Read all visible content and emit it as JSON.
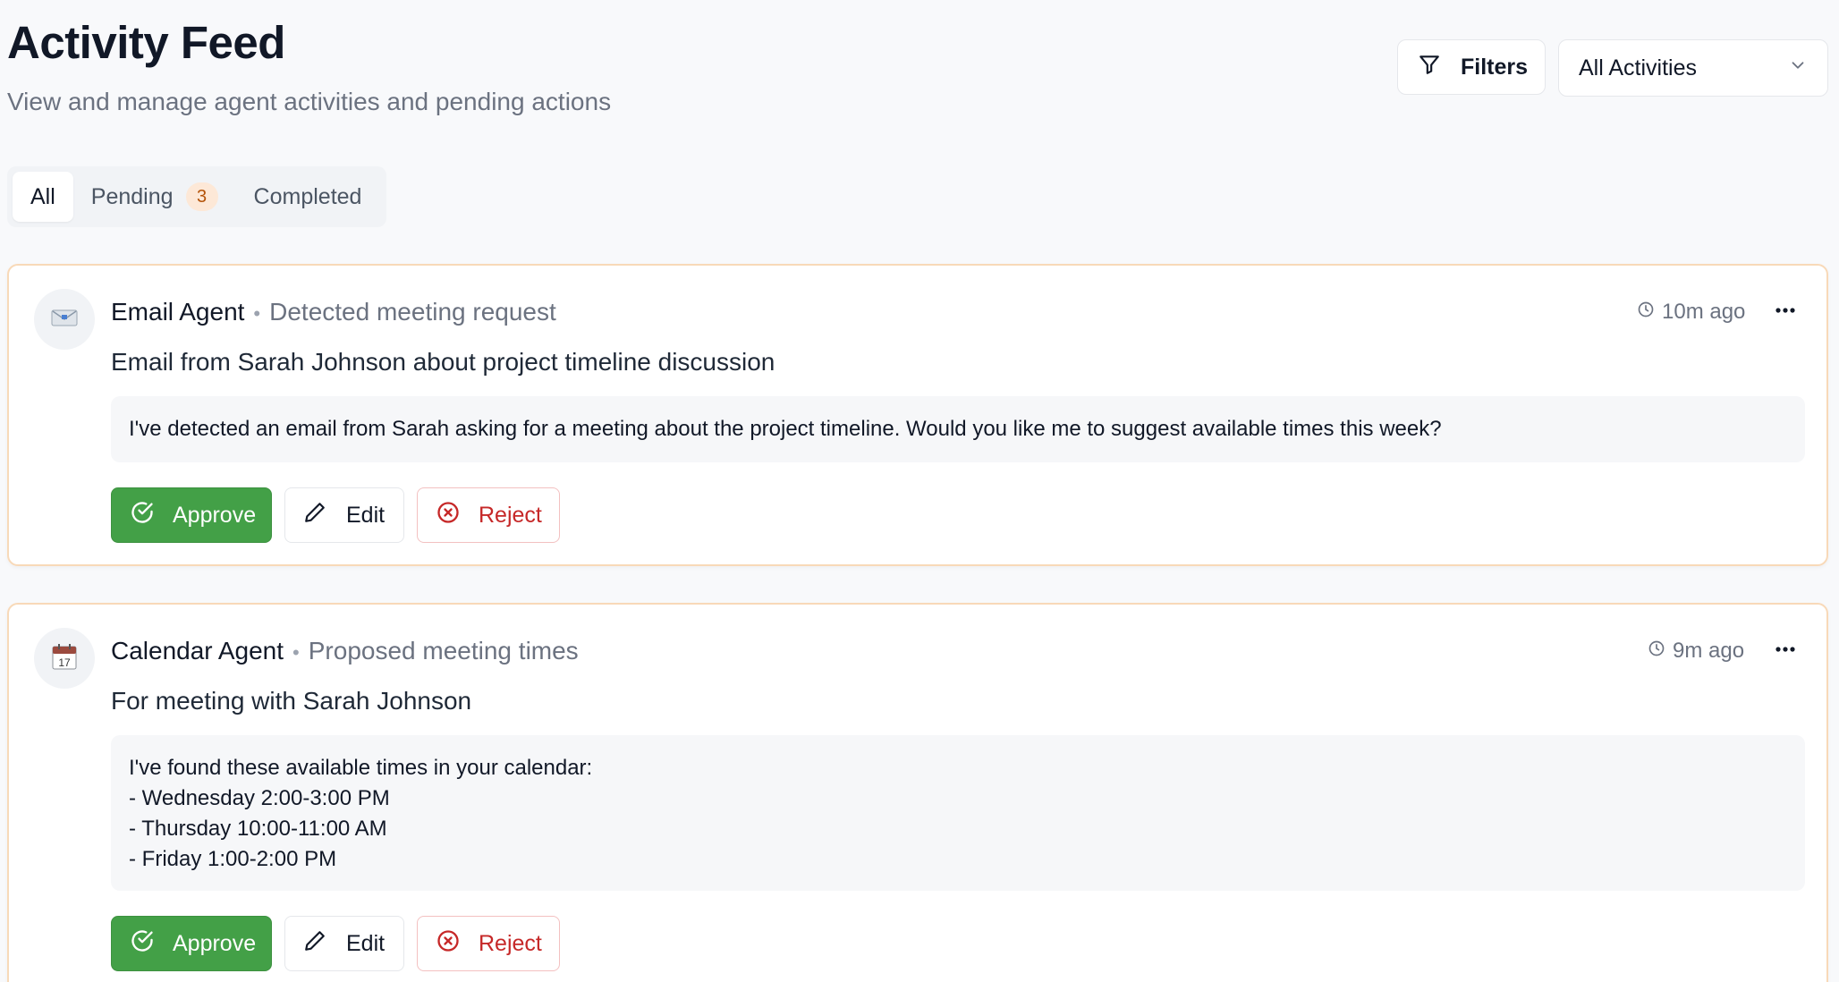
{
  "header": {
    "title": "Activity Feed",
    "subtitle": "View and manage agent activities and pending actions",
    "filters_label": "Filters",
    "activity_select_value": "All Activities"
  },
  "tabs": [
    {
      "label": "All",
      "active": true
    },
    {
      "label": "Pending",
      "count": "3"
    },
    {
      "label": "Completed"
    }
  ],
  "activities": [
    {
      "agent": "Email Agent",
      "action": "Detected meeting request",
      "time": "10m ago",
      "title": "Email from Sarah Johnson about project timeline discussion",
      "message_lines": [
        "I've detected an email from Sarah asking for a meeting about the project timeline. Would you like me to suggest available times this week?"
      ],
      "approve_label": "Approve",
      "edit_label": "Edit",
      "reject_label": "Reject",
      "icon": "envelope-icon"
    },
    {
      "agent": "Calendar Agent",
      "action": "Proposed meeting times",
      "time": "9m ago",
      "title": "For meeting with Sarah Johnson",
      "message_lines": [
        "I've found these available times in your calendar:",
        "- Wednesday 2:00-3:00 PM",
        "- Thursday 10:00-11:00 AM",
        "- Friday 1:00-2:00 PM"
      ],
      "approve_label": "Approve",
      "edit_label": "Edit",
      "reject_label": "Reject",
      "icon": "calendar-icon",
      "calendar_day": "17"
    }
  ],
  "colors": {
    "approve": "#43a047",
    "reject": "#c62828",
    "pending_badge_bg": "#fde8d7",
    "card_border": "#f8d9b8"
  },
  "separator": "•"
}
